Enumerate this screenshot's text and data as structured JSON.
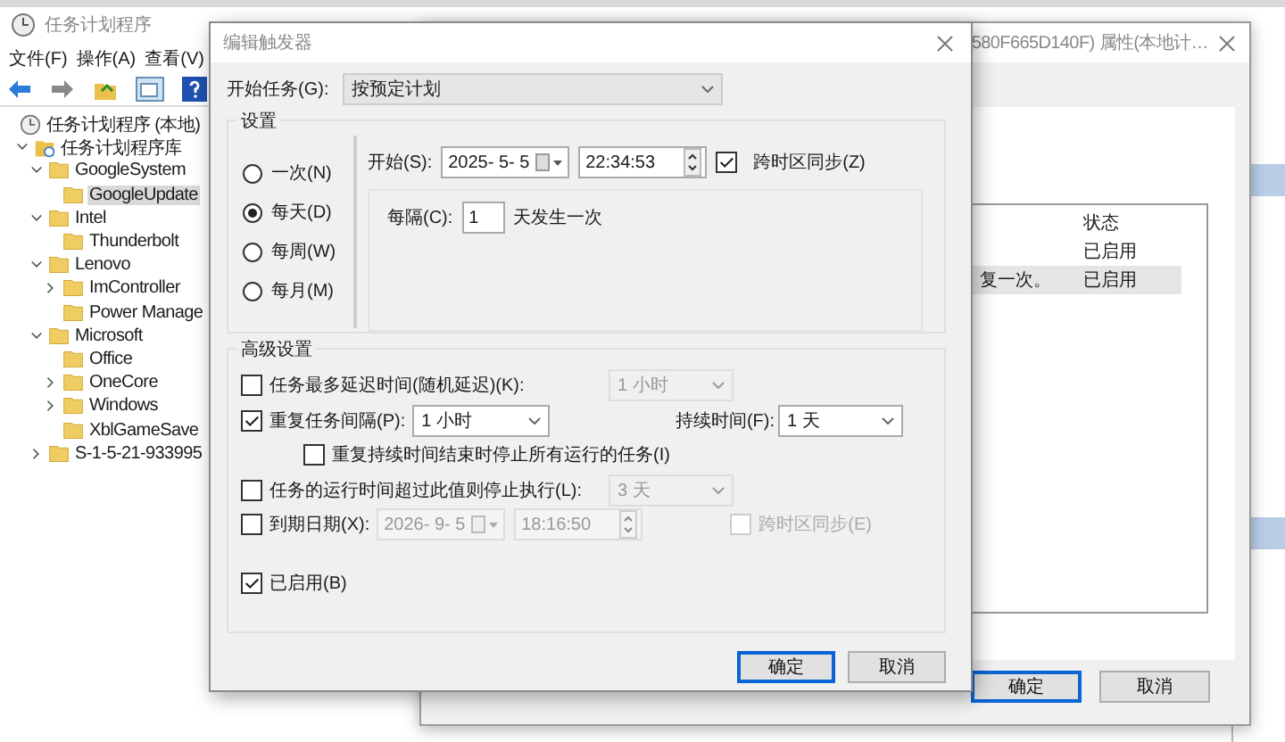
{
  "main_window": {
    "title": "任务计划程序",
    "menu": [
      "文件(F)",
      "操作(A)",
      "查看(V)"
    ],
    "tree": [
      {
        "label": "任务计划程序 (本地)",
        "kind": "root",
        "selected": false,
        "children": [
          {
            "label": "任务计划程序库",
            "kind": "library",
            "expanded": true,
            "selected": false,
            "children": [
              {
                "label": "GoogleSystem",
                "kind": "folder",
                "expanded": true,
                "selected": false,
                "children": [
                  {
                    "label": "GoogleUpdate",
                    "kind": "folder",
                    "selected": true
                  }
                ]
              },
              {
                "label": "Intel",
                "kind": "folder",
                "expanded": true,
                "selected": false,
                "children": [
                  {
                    "label": "Thunderbolt",
                    "kind": "folder",
                    "selected": false
                  }
                ]
              },
              {
                "label": "Lenovo",
                "kind": "folder",
                "expanded": true,
                "selected": false,
                "children": [
                  {
                    "label": "ImController",
                    "kind": "folder",
                    "expanded": false,
                    "selected": false
                  },
                  {
                    "label": "Power Manage",
                    "kind": "folder",
                    "selected": false
                  }
                ]
              },
              {
                "label": "Microsoft",
                "kind": "folder",
                "expanded": true,
                "selected": false,
                "children": [
                  {
                    "label": "Office",
                    "kind": "folder",
                    "selected": false
                  },
                  {
                    "label": "OneCore",
                    "kind": "folder",
                    "expanded": false,
                    "selected": false
                  },
                  {
                    "label": "Windows",
                    "kind": "folder",
                    "expanded": false,
                    "selected": false
                  },
                  {
                    "label": "XblGameSave",
                    "kind": "folder",
                    "selected": false
                  }
                ]
              },
              {
                "label": "S-1-5-21-933995",
                "kind": "folder",
                "expanded": false,
                "selected": false
              }
            ]
          }
        ]
      }
    ]
  },
  "properties_window": {
    "title": "580F665D140F) 属性(本地计…",
    "columns": [
      "状态"
    ],
    "rows": [
      {
        "column_1": "",
        "status": "已启用",
        "selected": false
      },
      {
        "column_1": "复一次。",
        "status": "已启用",
        "selected": true
      }
    ],
    "buttons": [
      {
        "label": "确定",
        "default": true
      },
      {
        "label": "取消",
        "default": false
      }
    ]
  },
  "dialog": {
    "title": "编辑触发器",
    "start_task": {
      "label": "开始任务(G):",
      "value": "按预定计划"
    },
    "settings": {
      "title": "设置",
      "schedules": [
        {
          "label": "一次(N)",
          "selected": false
        },
        {
          "label": "每天(D)",
          "selected": true
        },
        {
          "label": "每周(W)",
          "selected": false
        },
        {
          "label": "每月(M)",
          "selected": false
        }
      ],
      "start": {
        "label": "开始(S):",
        "date": "2025-  5-  5",
        "time": "22:34:53"
      },
      "sync_timezones": {
        "label": "跨时区同步(Z)",
        "checked": true
      },
      "recur": {
        "label": "每隔(C):",
        "value": "1",
        "suffix": "天发生一次"
      }
    },
    "advanced": {
      "title": "高级设置",
      "delay": {
        "label": "任务最多延迟时间(随机延迟)(K):",
        "checked": false,
        "value": "1 小时"
      },
      "repeat": {
        "label": "重复任务间隔(P):",
        "checked": true,
        "value": "1 小时",
        "duration_label": "持续时间(F):",
        "duration": "1 天"
      },
      "stop_at_end": {
        "label": "重复持续时间结束时停止所有运行的任务(I)",
        "checked": false
      },
      "stop_if_longer": {
        "label": "任务的运行时间超过此值则停止执行(L):",
        "checked": false,
        "value": "3 天"
      },
      "expire": {
        "label": "到期日期(X):",
        "checked": false,
        "date": "2026-  9-  5",
        "time": "18:16:50",
        "sync_label": "跨时区同步(E)",
        "sync_checked": false
      },
      "enabled": {
        "label": "已启用(B)",
        "checked": true
      }
    },
    "buttons": [
      {
        "label": "确定",
        "default": true
      },
      {
        "label": "取消",
        "default": false
      }
    ]
  }
}
